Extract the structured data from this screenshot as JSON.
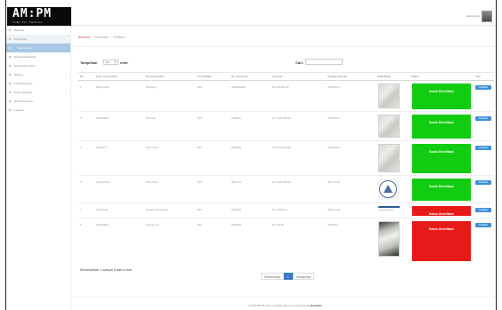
{
  "app": {
    "logo_text": "AM:PM",
    "logo_subtitle": "Time For Fashion",
    "user_name": "adminstore"
  },
  "sidebar": {
    "items": [
      {
        "label": "Beranda",
        "state": "normal",
        "has_chevron": false
      },
      {
        "label": "Konfirmasi",
        "state": "open",
        "has_chevron": true
      },
      {
        "label": "Semua Data",
        "state": "active",
        "has_chevron": false
      },
      {
        "label": "Sudah Diverifikasi",
        "state": "normal",
        "has_chevron": false
      },
      {
        "label": "Belum Diverifikasi",
        "state": "normal",
        "has_chevron": false
      },
      {
        "label": "Barang",
        "state": "normal",
        "has_chevron": true
      },
      {
        "label": "Kelola Kategori",
        "state": "normal",
        "has_chevron": false
      },
      {
        "label": "Data Transaksi",
        "state": "normal",
        "has_chevron": true
      },
      {
        "label": "Data Pengguna",
        "state": "normal",
        "has_chevron": false
      },
      {
        "label": "Laporan",
        "state": "normal",
        "has_chevron": false
      }
    ]
  },
  "breadcrumb": {
    "home": "Beranda",
    "level1": "Konfirmasi",
    "level2": "Verifikasi"
  },
  "controls": {
    "show_label": "Tampilkan",
    "show_value": "10",
    "entries_label": "entri",
    "search_label": "Cari:",
    "search_value": ""
  },
  "table": {
    "headers": [
      "No.",
      "Kode Pemesanan",
      "Nama Pengirim",
      "Nama Bank",
      "No. Rekening",
      "Nominal",
      "Tanggal Transfer",
      "Bukti Bayar",
      "Status",
      "Aksi"
    ],
    "rows": [
      {
        "no": "1",
        "kode": "8dNyUtPE3",
        "nama": "Wicaang",
        "bank": "BNI",
        "rekening": "3262828020",
        "nominal": "Rp 262.000,00",
        "tanggal": "2018-06-27",
        "proof": "paper",
        "status": "Sudah Diverifikasi",
        "ok": true,
        "action": "Verifikasi"
      },
      {
        "no": "2",
        "kode": "3GaW8B9X",
        "nama": "Wicaang",
        "bank": "BNI",
        "rekening": "1496891",
        "nominal": "Rp 7.000.000,00",
        "tanggal": "2018-06-27",
        "proof": "paper",
        "status": "Sudah Diverifikasi",
        "ok": true,
        "action": "Verifikasi"
      },
      {
        "no": "3",
        "kode": "faQTHhYf",
        "nama": "Dewi Aurel",
        "bank": "BNI",
        "rekening": "9544894",
        "nominal": "Rp 8.600.000,00",
        "tanggal": "2018-06-27",
        "proof": "paper",
        "status": "Sudah Diverifikasi",
        "ok": true,
        "action": "Verifikasi"
      },
      {
        "no": "4",
        "kode": "g2XSGuvKz",
        "nama": "Dewi Aurel",
        "bank": "BNI",
        "rekening": "9827075",
        "nominal": "Rp 3.960.000,00",
        "tanggal": "2017-11-24",
        "proof": "logo",
        "status": "Sudah Diverifikasi",
        "ok": true,
        "action": "Verifikasi"
      },
      {
        "no": "5",
        "kode": "ZuAvNyrK",
        "nama": "Panggo Wicaanggo",
        "bank": "BNI",
        "rekening": "1970639",
        "nominal": "Rp 79.000,00",
        "tanggal": "2018-10-16",
        "proof": "strip",
        "status": "Belum Diverifikasi",
        "ok": false,
        "action": "Verifikasi"
      },
      {
        "no": "6",
        "kode": "D3Hn66Wq",
        "nama": "Lintang sari",
        "bank": "BNI",
        "rekening": "8023934",
        "nominal": "Rp 292.00",
        "tanggal": "2018-03-1",
        "proof": "dark",
        "status": "Belum Diverifikasi",
        "ok": false,
        "action": "Verifikasi"
      }
    ]
  },
  "info_text": "Menampilkan 1 sampai 6 dari 6 entri",
  "pagination": {
    "prev": "Sebelumnya",
    "current": "1",
    "next": "Selanjutnya"
  },
  "footer": {
    "text": "© 2018 AM:PM Store, All Rights Reserved | Powered by",
    "brand": "Semantec"
  },
  "colors": {
    "verified": "#12cc12",
    "unverified": "#e81919",
    "primary": "#3a78c2",
    "sidebar_active": "#a8c8e4"
  }
}
